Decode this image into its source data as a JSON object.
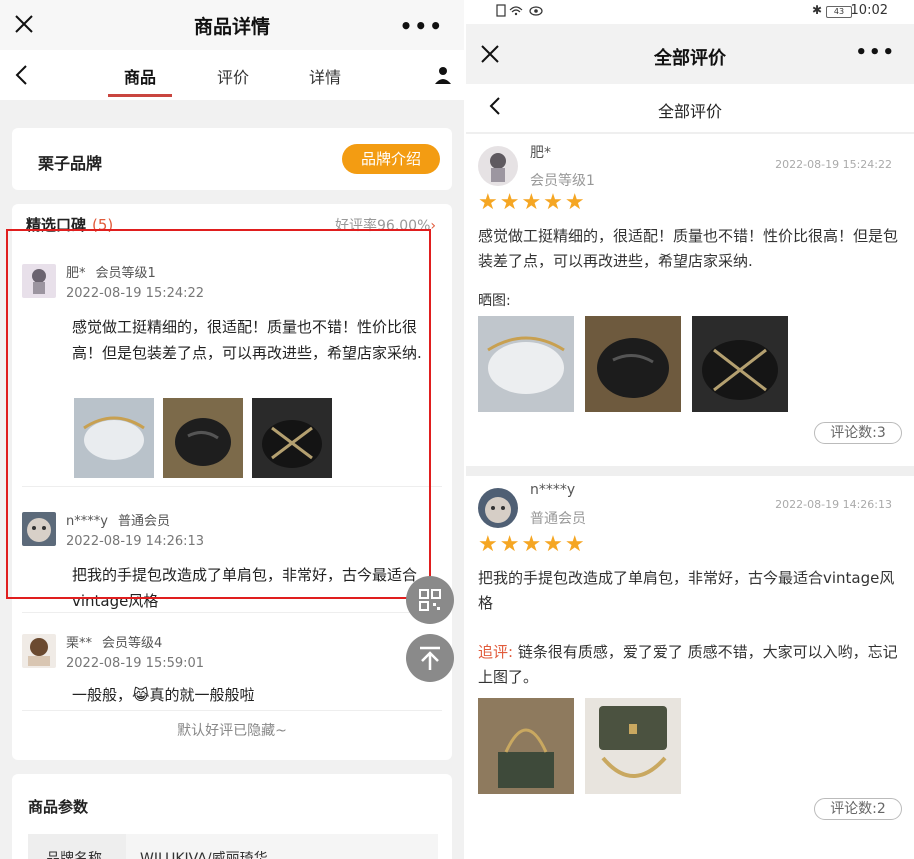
{
  "left": {
    "window_title": "商品详情",
    "more": "•••",
    "tabs": [
      {
        "label": "商品"
      },
      {
        "label": "评价"
      },
      {
        "label": "详情"
      }
    ],
    "brand": {
      "name": "栗子品牌",
      "button": "品牌介绍"
    },
    "reviews": {
      "heading": "精选口碑",
      "count": "(5)",
      "rate": "好评率96.00%",
      "items": [
        {
          "name": "肥*",
          "level": "会员等级1",
          "date": "2022-08-19 15:24:22",
          "text": "感觉做工挺精细的，很适配！质量也不错！性价比很高！但是包装差了点，可以再改进些，希望店家采纳."
        },
        {
          "name": "n****y",
          "level": "普通会员",
          "date": "2022-08-19 14:26:13",
          "text": "把我的手提包改造成了单肩包，非常好，古今最适合vintage风格"
        },
        {
          "name": "栗**",
          "level": "会员等级4",
          "date": "2022-08-19 15:59:01",
          "text": "一般般，😹真的就一般般啦"
        }
      ],
      "hidden_note": "默认好评已隐藏~"
    },
    "params": {
      "title": "商品参数",
      "key": "品牌名称",
      "value": "WILUKIVA/威丽琦华"
    }
  },
  "right": {
    "status_bar": {
      "time": "10:02",
      "battery": "43"
    },
    "window_title": "全部评价",
    "more": "•••",
    "sub_title": "全部评价",
    "reviews": [
      {
        "name": "肥*",
        "level": "会员等级1",
        "date": "2022-08-19 15:24:22",
        "stars": "★★★★★",
        "text": "感觉做工挺精细的，很适配！质量也不错！性价比很高！但是包装差了点，可以再改进些，希望店家采纳.",
        "images_label": "晒图:",
        "comments": "评论数:3"
      },
      {
        "name": "n****y",
        "level": "普通会员",
        "date": "2022-08-19 14:26:13",
        "stars": "★★★★★",
        "text": "把我的手提包改造成了单肩包，非常好，古今最适合vintage风格",
        "follow_tag": "追评:",
        "follow_text": "链条很有质感，爱了爱了 质感不错，大家可以入哟，忘记上图了。",
        "comments": "评论数:2"
      }
    ]
  }
}
